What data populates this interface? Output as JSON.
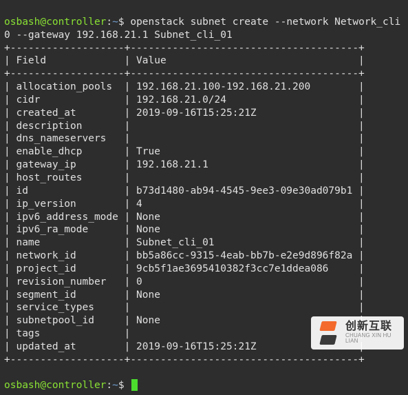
{
  "prompt": {
    "user_host": "osbash@controller",
    "path": "~",
    "symbol": "$"
  },
  "command": {
    "line1": "openstack subnet create --network Network_cli",
    "line2": "0 --gateway 192.168.21.1 Subnet_cli_01"
  },
  "table": {
    "header_field": "Field",
    "header_value": "Value",
    "rows": [
      {
        "field": "allocation_pools",
        "value": "192.168.21.100-192.168.21.200"
      },
      {
        "field": "cidr",
        "value": "192.168.21.0/24"
      },
      {
        "field": "created_at",
        "value": "2019-09-16T15:25:21Z"
      },
      {
        "field": "description",
        "value": ""
      },
      {
        "field": "dns_nameservers",
        "value": ""
      },
      {
        "field": "enable_dhcp",
        "value": "True"
      },
      {
        "field": "gateway_ip",
        "value": "192.168.21.1"
      },
      {
        "field": "host_routes",
        "value": ""
      },
      {
        "field": "id",
        "value": "b73d1480-ab94-4545-9ee3-09e30ad079b1"
      },
      {
        "field": "ip_version",
        "value": "4"
      },
      {
        "field": "ipv6_address_mode",
        "value": "None"
      },
      {
        "field": "ipv6_ra_mode",
        "value": "None"
      },
      {
        "field": "name",
        "value": "Subnet_cli_01"
      },
      {
        "field": "network_id",
        "value": "bb5a86cc-9315-4eab-bb7b-e2e9d896f82a"
      },
      {
        "field": "project_id",
        "value": "9cb5f1ae3695410382f3cc7e1ddea086"
      },
      {
        "field": "revision_number",
        "value": "0"
      },
      {
        "field": "segment_id",
        "value": "None"
      },
      {
        "field": "service_types",
        "value": ""
      },
      {
        "field": "subnetpool_id",
        "value": "None"
      },
      {
        "field": "tags",
        "value": ""
      },
      {
        "field": "updated_at",
        "value": "2019-09-16T15:25:21Z"
      }
    ]
  },
  "watermark": {
    "zh": "创新互联",
    "en": "CHUANG XIN HU LIAN"
  }
}
